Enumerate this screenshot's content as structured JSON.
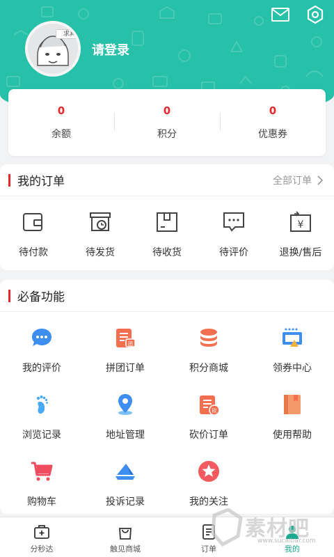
{
  "header": {
    "login_label": "请登录",
    "avatar_badge": "求真",
    "icons": [
      "mail-icon",
      "settings-icon"
    ]
  },
  "stats": [
    {
      "value": "0",
      "label": "余额"
    },
    {
      "value": "0",
      "label": "积分"
    },
    {
      "value": "0",
      "label": "优惠券"
    }
  ],
  "orders": {
    "title": "我的订单",
    "more_label": "全部订单",
    "items": [
      {
        "label": "待付款",
        "icon": "wallet-icon"
      },
      {
        "label": "待发货",
        "icon": "package-clock-icon"
      },
      {
        "label": "待收货",
        "icon": "box-icon"
      },
      {
        "label": "待评价",
        "icon": "comment-icon"
      },
      {
        "label": "退换/售后",
        "icon": "refund-icon"
      }
    ]
  },
  "functions": {
    "title": "必备功能",
    "items": [
      {
        "label": "我的评价",
        "icon": "chat-bubble-icon"
      },
      {
        "label": "拼团订单",
        "icon": "group-order-icon"
      },
      {
        "label": "积分商城",
        "icon": "coins-icon"
      },
      {
        "label": "领券中心",
        "icon": "coupon-icon"
      },
      {
        "label": "浏览记录",
        "icon": "footprint-icon"
      },
      {
        "label": "地址管理",
        "icon": "location-pin-icon"
      },
      {
        "label": "砍价订单",
        "icon": "bargain-order-icon"
      },
      {
        "label": "使用帮助",
        "icon": "help-book-icon"
      },
      {
        "label": "购物车",
        "icon": "shopping-cart-icon"
      },
      {
        "label": "投诉记录",
        "icon": "complaint-icon"
      },
      {
        "label": "我的关注",
        "icon": "star-icon"
      }
    ]
  },
  "tabbar": {
    "active": "我的",
    "items": [
      {
        "label": "分秒达",
        "icon": "delivery-box-icon"
      },
      {
        "label": "触见商城",
        "icon": "shopping-bag-icon"
      },
      {
        "label": "订单",
        "icon": "order-list-icon"
      },
      {
        "label": "我的",
        "icon": "user-icon"
      }
    ]
  },
  "watermark": {
    "text": "素材吧",
    "url": "www.sucaibar.com"
  },
  "colors": {
    "brand_teal": "#27c0a9",
    "accent_red": "#e8282b",
    "active_tab": "#1aa991"
  }
}
